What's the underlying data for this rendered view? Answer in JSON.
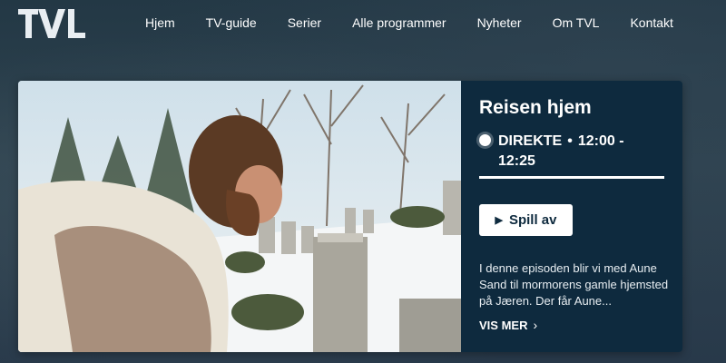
{
  "header": {
    "logo_text": "TVL",
    "nav": [
      "Hjem",
      "TV-guide",
      "Serier",
      "Alle programmer",
      "Nyheter",
      "Om TVL",
      "Kontakt"
    ]
  },
  "hero": {
    "title": "Reisen hjem",
    "live_label": "DIREKTE",
    "separator": "•",
    "time": "12:00 - 12:25",
    "progress": 1.0,
    "play_label": "Spill av",
    "play_icon": "play-icon",
    "description": "I denne episoden blir vi med Aune Sand til mormorens gamle hjemsted på Jæren. Der får Aune...",
    "more_label": "VIS MER",
    "more_icon": "chevron-right-icon"
  },
  "colors": {
    "panel": "#0e2a3e",
    "background": "#2b3e4b",
    "button": "#ffffff"
  }
}
